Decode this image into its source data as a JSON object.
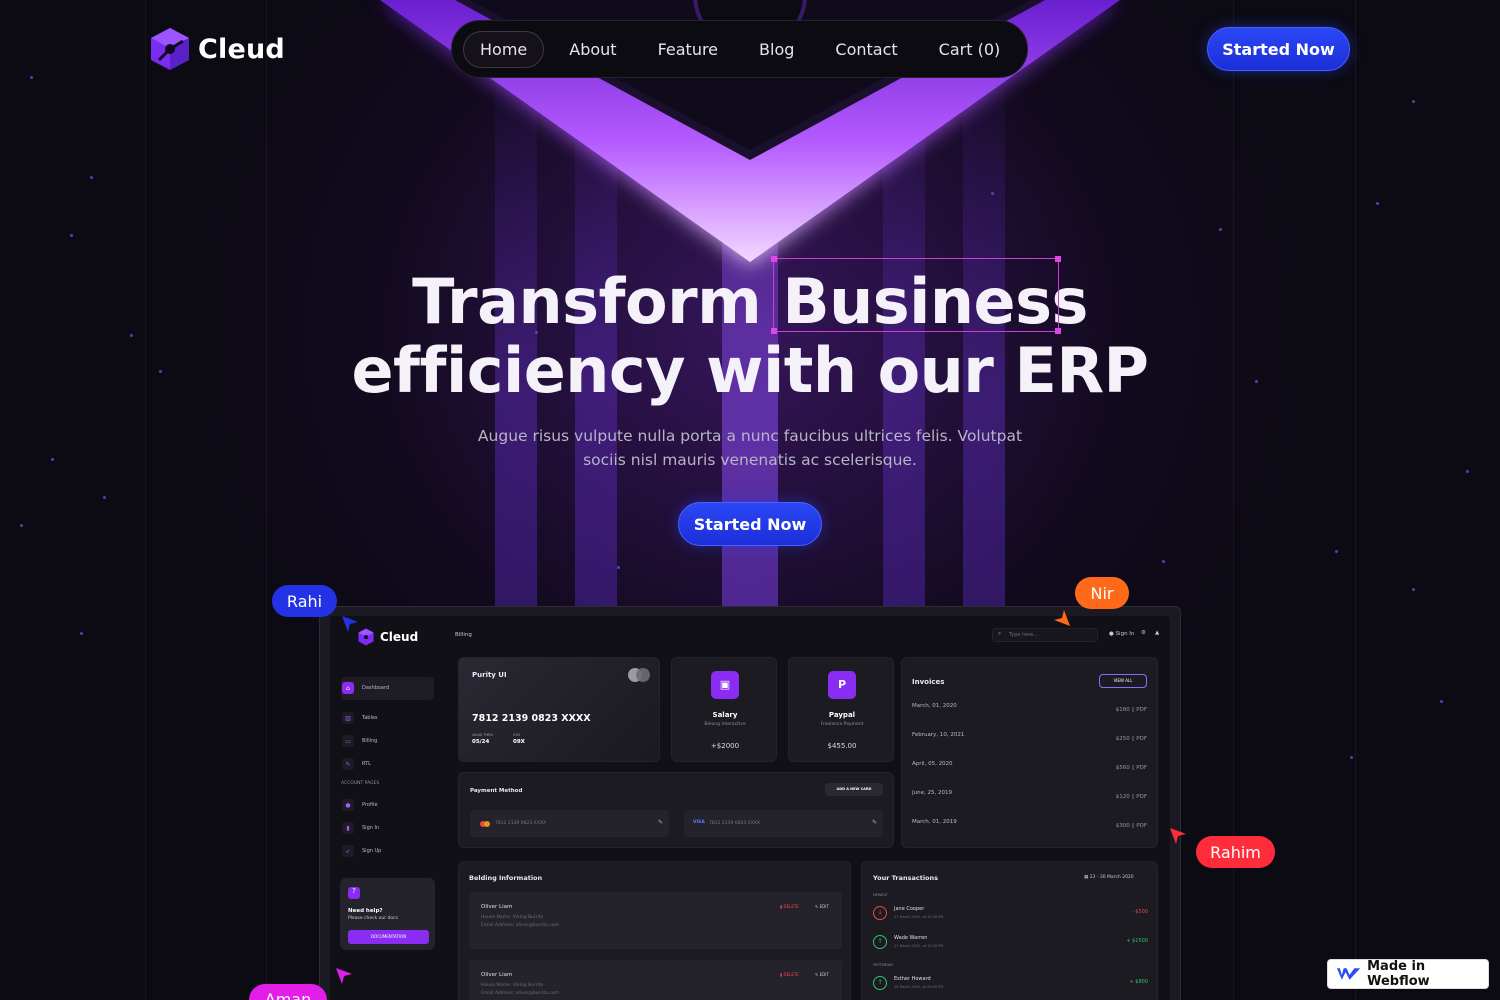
{
  "brand": {
    "name": "Cleud",
    "accent": "#7b2cf0",
    "button": "#1f35e0"
  },
  "nav": {
    "items": [
      "Home",
      "About",
      "Feature",
      "Blog",
      "Contact",
      "Cart (0)"
    ],
    "active": "Home"
  },
  "header": {
    "cta": "Started Now"
  },
  "hero": {
    "line1": "Transform Business",
    "line2": "efficiency with our ERP",
    "subtitle_1": "Augue risus vulpute nulla porta a nunc faucibus ultrices felis. Volutpat",
    "subtitle_2": "sociis nisl mauris venenatis ac scelerisque.",
    "cta": "Started Now"
  },
  "cursors": [
    {
      "name": "Rahi",
      "color": "#2432e6"
    },
    {
      "name": "Nir",
      "color": "#ff6a1a"
    },
    {
      "name": "Rahim",
      "color": "#ff2d3c"
    },
    {
      "name": "Aman",
      "color": "#e21ee8"
    }
  ],
  "dashboard": {
    "brand": "Cleud",
    "crumb": "Billing",
    "search_placeholder": "Type here...",
    "sign_in": "Sign In",
    "sidebar": {
      "items": [
        "Dashboard",
        "Tables",
        "Billing",
        "RTL"
      ],
      "section": "ACCOUNT PAGES",
      "account": [
        "Profile",
        "Sign In",
        "Sign Up"
      ],
      "help_title": "Need help?",
      "help_sub": "Please check our docs",
      "help_btn": "DOCUMENTATION"
    },
    "card": {
      "brand": "Purity UI",
      "number": "7812 2139 0823 XXXX",
      "valid_label": "VALID THRU",
      "valid": "05/24",
      "cvv_label": "CVV",
      "cvv": "09X"
    },
    "salary": {
      "title": "Salary",
      "sub": "Belong Interactive",
      "amount": "+$2000"
    },
    "paypal": {
      "title": "Paypal",
      "sub": "Freelance Payment",
      "amount": "$455.00"
    },
    "invoices": {
      "title": "Invoices",
      "view_all": "VIEW ALL",
      "rows": [
        {
          "date": "March, 01, 2020",
          "amount": "$180"
        },
        {
          "date": "February, 10, 2021",
          "amount": "$250"
        },
        {
          "date": "April, 05, 2020",
          "amount": "$560"
        },
        {
          "date": "June, 25, 2019",
          "amount": "$120"
        },
        {
          "date": "March, 01, 2019",
          "amount": "$300"
        }
      ],
      "pdf": "PDF"
    },
    "payment": {
      "title": "Payment Method",
      "add": "ADD A NEW CARD",
      "card1": "7812 2139 0823 XXXX",
      "card2": "7812 2139 0823 XXXX",
      "visa": "VISA"
    },
    "billing": {
      "title": "Belding Information",
      "entries": [
        {
          "name": "Oliver Liam",
          "company": "House Name: Viking Burrito",
          "email": "Email Address: oliver@burrito.com"
        },
        {
          "name": "Oliver Liam",
          "company": "House Name: Viking Burrito",
          "email": "Email Address: oliver@burrito.com"
        }
      ],
      "delete": "DELETE",
      "edit": "EDIT"
    },
    "transactions": {
      "title": "Your Transactions",
      "range": "23 - 30 March 2020",
      "newest": "NEWEST",
      "yesterday": "YESTERDAY",
      "rows": [
        {
          "name": "Jane Cooper",
          "time": "27 March 2020, at 12:30 PM",
          "amount": "- $500",
          "color": "#e5484d"
        },
        {
          "name": "Wade Warren",
          "time": "27 March 2020, at 12:30 PM",
          "amount": "+ $1500",
          "color": "#30c46b"
        },
        {
          "name": "Esther Howard",
          "time": "26 March 2020, at 08:40 PM",
          "amount": "+ $800",
          "color": "#30c46b"
        }
      ]
    }
  },
  "badge": {
    "label": "Made in Webflow"
  }
}
